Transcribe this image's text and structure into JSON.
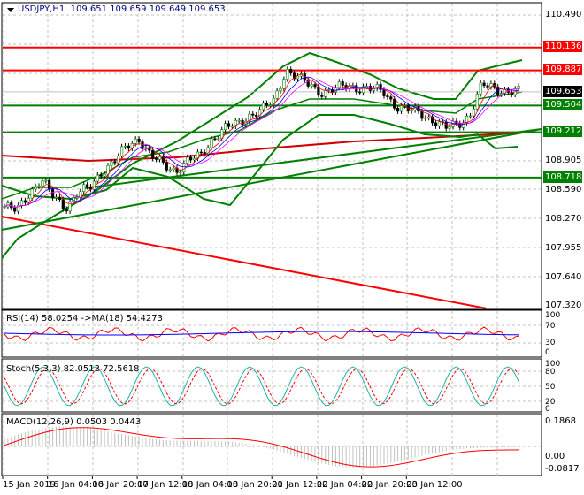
{
  "header": {
    "symbol": "USDJPY,H1",
    "ohlc": "109.651 109.659 109.649 109.653"
  },
  "price_axis": [
    "110.490",
    "108.905",
    "108.590",
    "108.270",
    "107.955",
    "107.640",
    "107.320"
  ],
  "level_tags": [
    {
      "value": "110.136",
      "color": "#ff0000"
    },
    {
      "value": "109.887",
      "color": "#ff0000"
    },
    {
      "value": "109.653",
      "color": "#000000"
    },
    {
      "value": "109.504",
      "color": "#008000"
    },
    {
      "value": "109.212",
      "color": "#008000"
    },
    {
      "value": "108.718",
      "color": "#008000"
    }
  ],
  "rsi": {
    "title": "RSI(14) 58.0254  ->MA(18) 54.4273",
    "axis": [
      "100",
      "70",
      "30",
      "0"
    ]
  },
  "stoch": {
    "title": "Stoch(5,3,3) 82.0513 72.5618",
    "axis": [
      "100",
      "80",
      "50",
      "20",
      "0"
    ]
  },
  "macd": {
    "title": "MACD(12,26,9) 0.0503 0.0443",
    "axis": [
      "0.1868",
      "0.00",
      "-0.0817"
    ]
  },
  "time_axis": [
    "15 Jan 2019",
    "16 Jan 04:00",
    "16 Jan 20:00",
    "17 Jan 12:00",
    "18 Jan 04:00",
    "18 Jan 20:00",
    "21 Jan 12:00",
    "22 Jan 04:00",
    "22 Jan 20:00",
    "23 Jan 12:00"
  ],
  "price_path": [
    108.4,
    108.35,
    108.55,
    108.7,
    108.5,
    108.4,
    108.55,
    108.6,
    108.8,
    108.9,
    109.05,
    109.15,
    108.95,
    108.85,
    108.8,
    108.9,
    108.95,
    109.15,
    109.25,
    109.3,
    109.4,
    109.45,
    109.55,
    109.9,
    109.8,
    109.72,
    109.65,
    109.68,
    109.72,
    109.7,
    109.68,
    109.65,
    109.5,
    109.45,
    109.42,
    109.35,
    109.25,
    109.3,
    109.4,
    109.72,
    109.7,
    109.66,
    109.65
  ],
  "colors": {
    "bull": "#008000",
    "bear": "#000000",
    "rsi": "#ff0000",
    "rsi_ma": "#0000ff",
    "stoch_main": "#20b2aa",
    "stoch_signal": "#ff0000",
    "macd_hist": "#c0c0c0",
    "macd_signal": "#ff0000"
  }
}
